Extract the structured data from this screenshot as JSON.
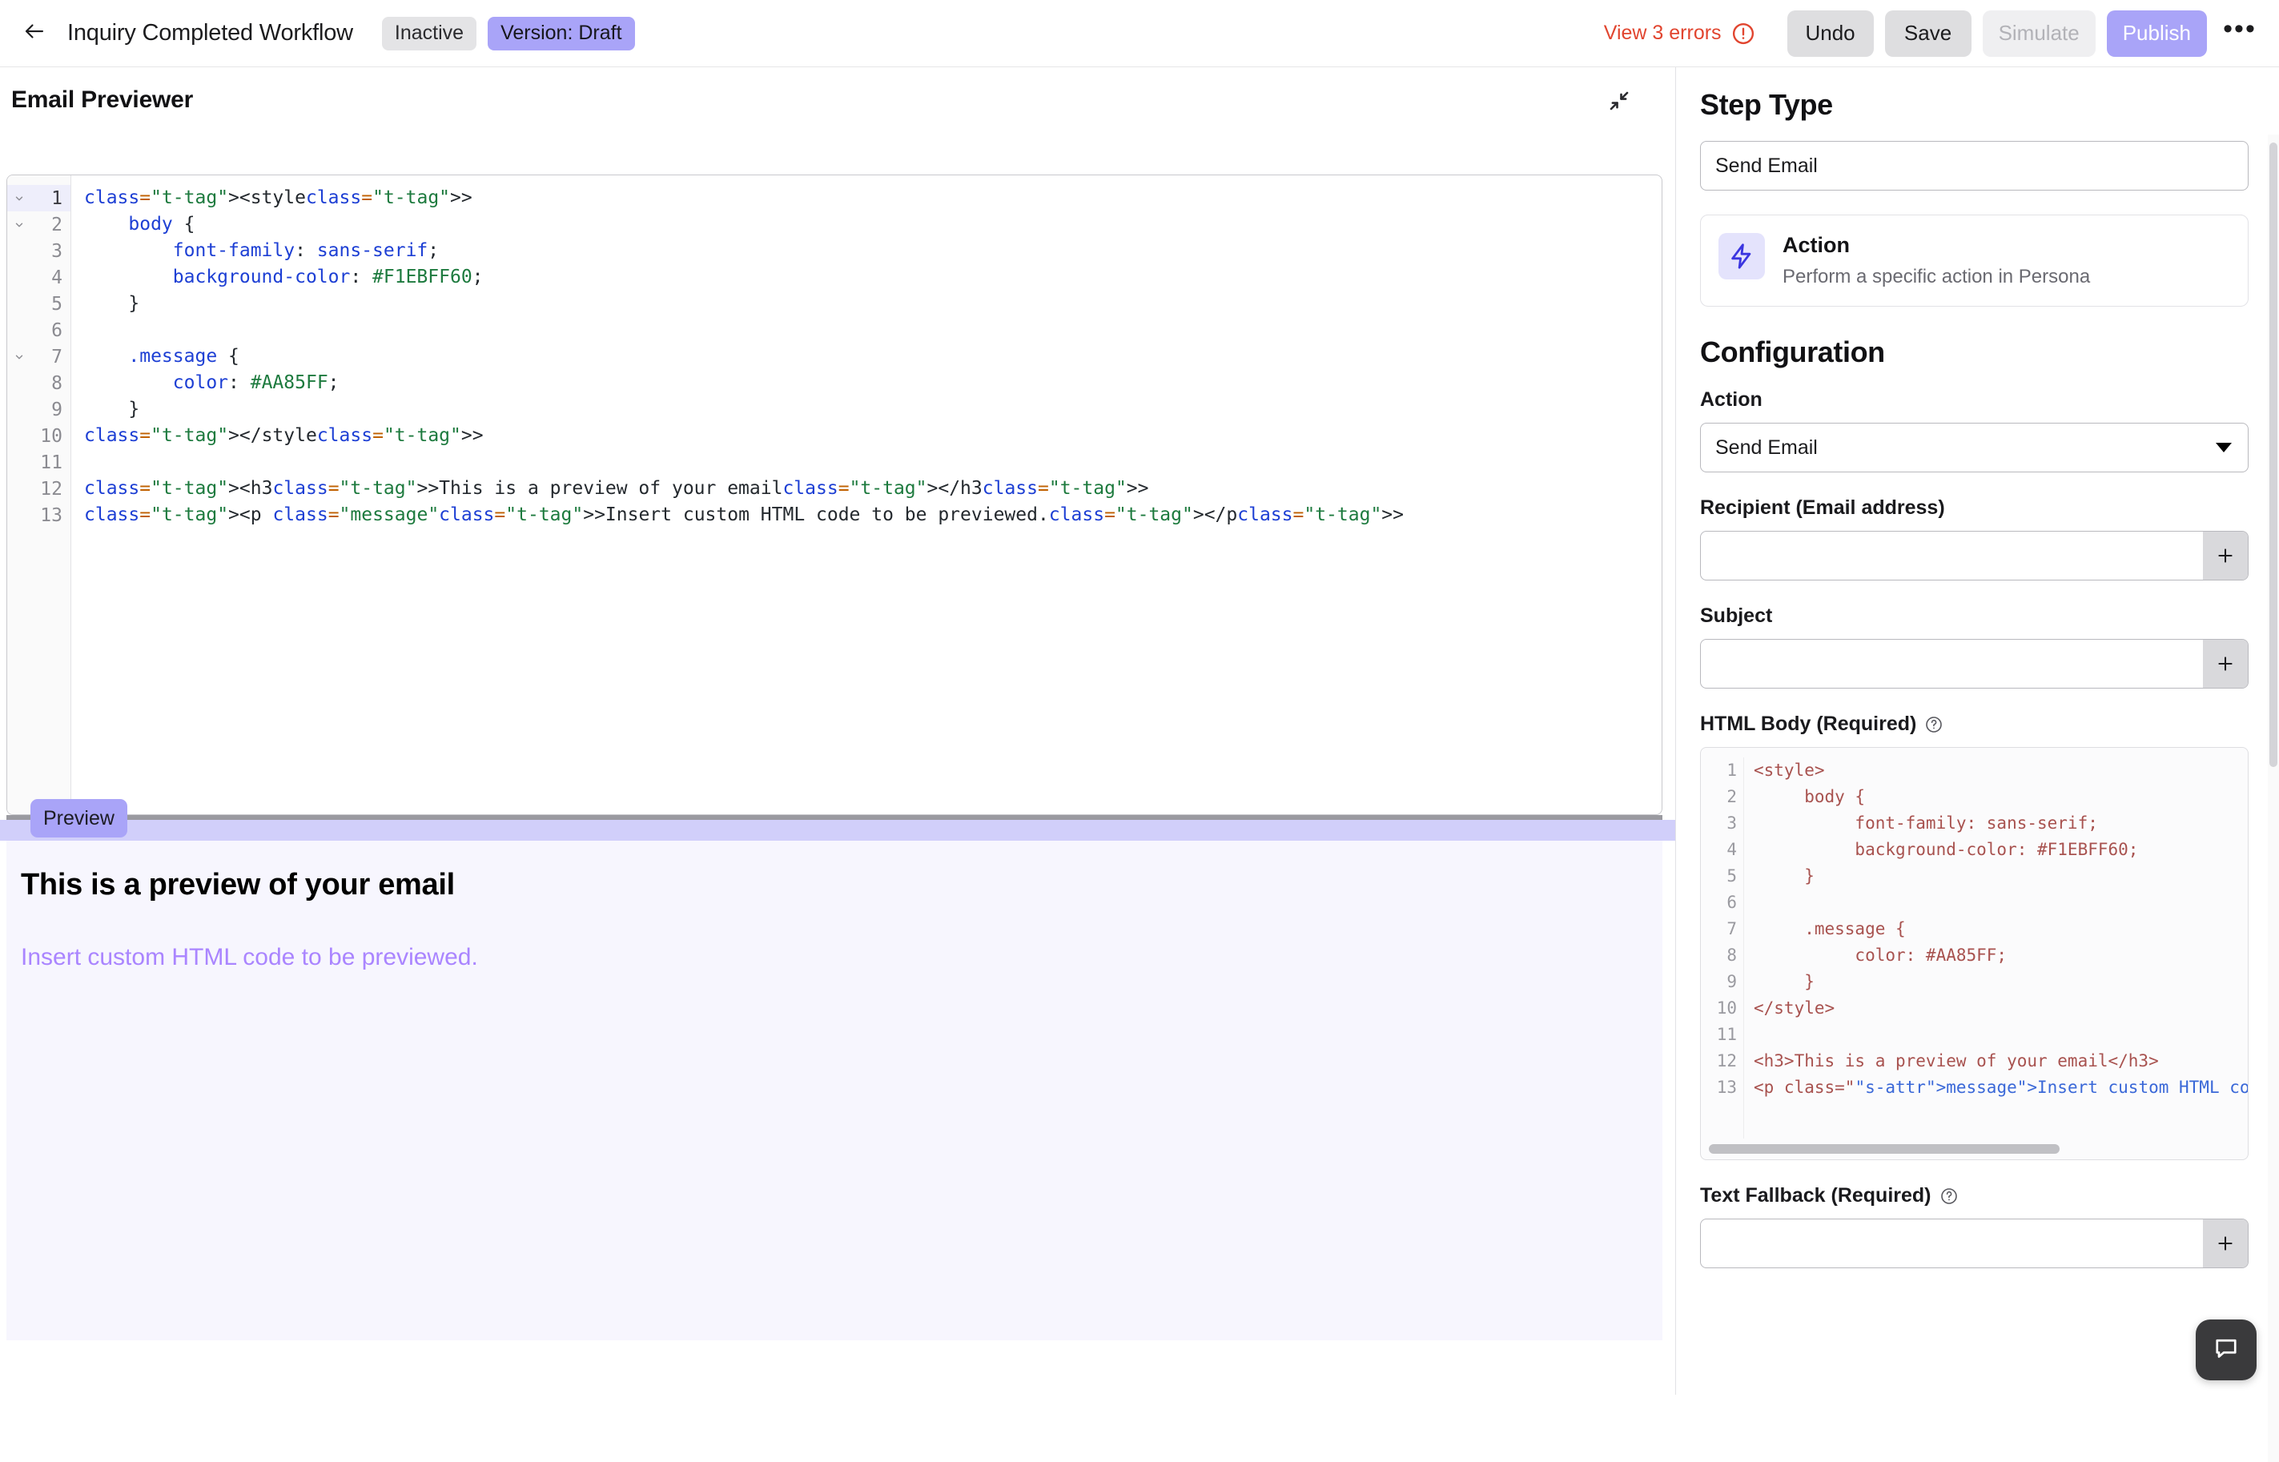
{
  "topbar": {
    "back_icon": "arrow-left-icon",
    "workflow_title": "Inquiry Completed Workflow",
    "status_chip": "Inactive",
    "version_chip": "Version: Draft",
    "errors_label": "View 3 errors",
    "error_icon": "alert-circle-icon",
    "undo_label": "Undo",
    "save_label": "Save",
    "simulate_label": "Simulate",
    "publish_label": "Publish",
    "overflow_label": "•••",
    "accent_color": "#A9A4F8",
    "error_color": "#E1452F"
  },
  "previewer": {
    "title": "Email Previewer",
    "collapse_icon": "collapse-arrows-icon",
    "preview_badge": "Preview",
    "preview_heading": "This is a preview of your email",
    "preview_paragraph": "Insert custom HTML code to be previewed.",
    "preview_text_color": "#AA85FF",
    "preview_bg_color": "#F7F6FE",
    "editor": {
      "line_numbers": [
        1,
        2,
        3,
        4,
        5,
        6,
        7,
        8,
        9,
        10,
        11,
        12,
        13
      ],
      "fold_lines": [
        1,
        2,
        7
      ],
      "active_line": 1,
      "lines": [
        "<style>",
        "    body {",
        "        font-family: sans-serif;",
        "        background-color: #F1EBFF60;",
        "    }",
        "",
        "    .message {",
        "        color: #AA85FF;",
        "    }",
        "</style>",
        "",
        "<h3>This is a preview of your email</h3>",
        "<p class=\"message\">Insert custom HTML code to be previewed.</p>"
      ]
    }
  },
  "sidebar": {
    "step_type_title": "Step Type",
    "step_type_value": "Send Email",
    "action_card": {
      "icon": "lightning-bolt-icon",
      "name": "Action",
      "description": "Perform a specific action in Persona"
    },
    "configuration_title": "Configuration",
    "action_label": "Action",
    "action_value": "Send Email",
    "recipient_label": "Recipient (Email address)",
    "recipient_value": "",
    "recipient_placeholder": "",
    "subject_label": "Subject",
    "subject_value": "",
    "subject_placeholder": "",
    "html_body_label": "HTML Body (Required)",
    "html_body_help_icon": "question-circle-icon",
    "text_fallback_label": "Text Fallback (Required)",
    "text_fallback_help_icon": "question-circle-icon",
    "add_icon": "plus-icon",
    "dropdown_icon": "chevron-down-icon",
    "html_body_editor": {
      "line_numbers": [
        1,
        2,
        3,
        4,
        5,
        6,
        7,
        8,
        9,
        10,
        11,
        12,
        13
      ],
      "lines": [
        "<style>",
        "     body {",
        "          font-family: sans-serif;",
        "          background-color: #F1EBFF60;",
        "     }",
        "",
        "     .message {",
        "          color: #AA85FF;",
        "     }",
        "</style>",
        "",
        "<h3>This is a preview of your email</h3>",
        "<p class=\"message\">Insert custom HTML code to"
      ]
    }
  },
  "chat": {
    "icon": "chat-bubble-icon"
  }
}
